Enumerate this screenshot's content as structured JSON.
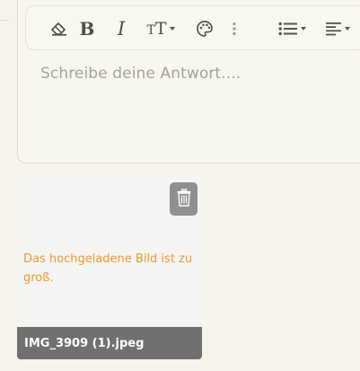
{
  "editor": {
    "placeholder": "Schreibe deine Antwort....",
    "toolbar": {
      "buttons": [
        {
          "name": "clear-format",
          "icon": "eraser-icon"
        },
        {
          "name": "bold",
          "label": "B",
          "icon": "bold-icon"
        },
        {
          "name": "italic",
          "label": "I",
          "icon": "italic-icon"
        },
        {
          "name": "font-size",
          "icon": "text-size-icon",
          "has_dropdown": true
        },
        {
          "name": "color",
          "icon": "palette-icon"
        },
        {
          "name": "more",
          "icon": "more-vertical-icon"
        },
        {
          "name": "list",
          "icon": "bulleted-list-icon",
          "has_dropdown": true
        },
        {
          "name": "align",
          "icon": "align-left-icon",
          "has_dropdown": true
        }
      ]
    }
  },
  "attachment": {
    "error": "Das hochgeladene Bild ist zu groß.",
    "filename": "IMG_3909 (1).jpeg",
    "delete_icon": "trash-icon"
  },
  "colors": {
    "error": "#ed9a2f",
    "file_bar": "#707070",
    "delete_button": "#8f8f8f"
  }
}
